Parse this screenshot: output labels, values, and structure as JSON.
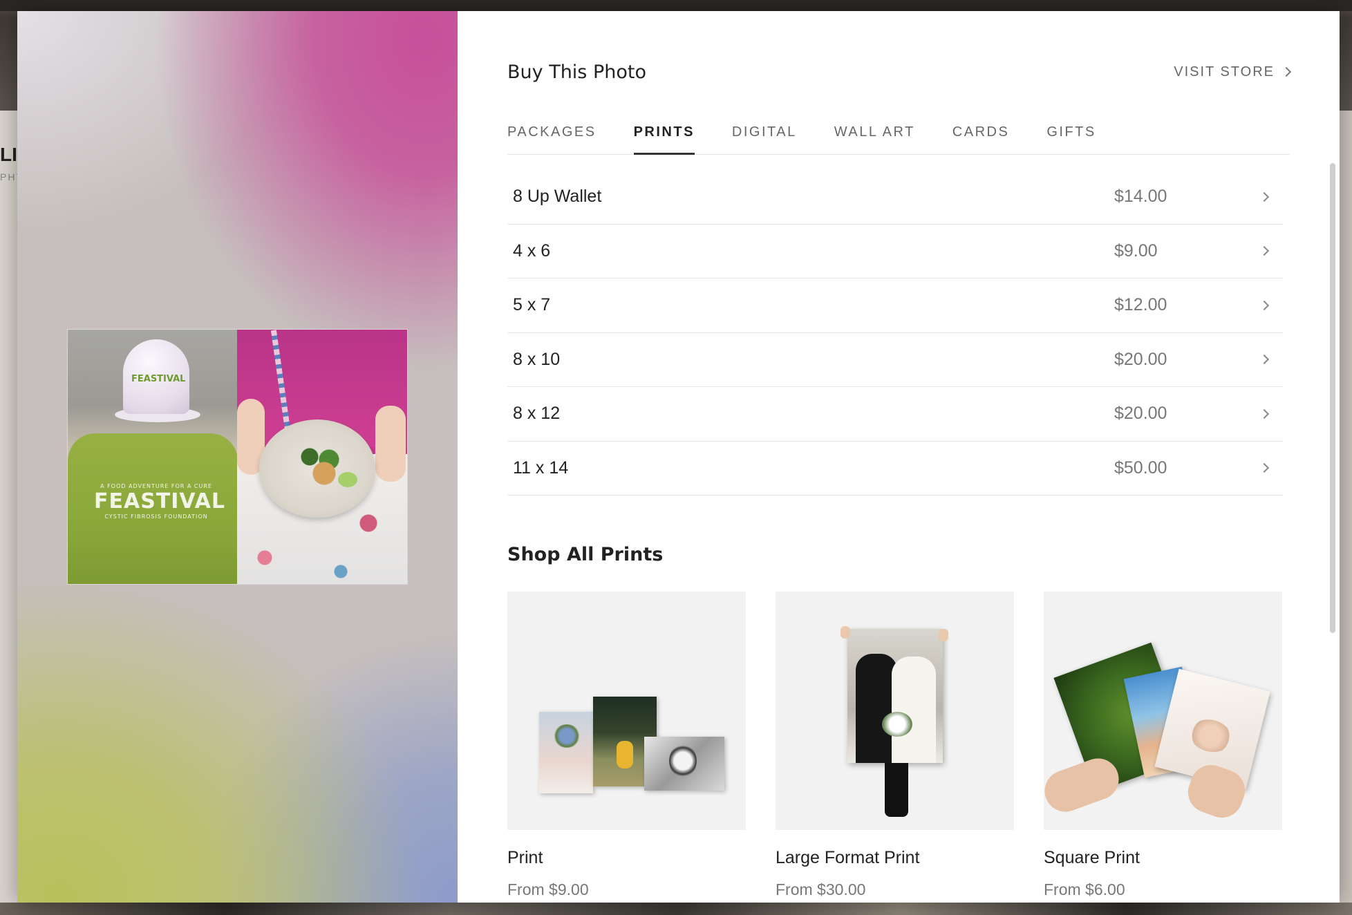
{
  "background": {
    "left_partial_title": "LI",
    "left_partial_subtitle": "PHY"
  },
  "panel": {
    "title": "Buy This Photo",
    "visit_store_label": "VISIT STORE"
  },
  "tabs": [
    {
      "label": "PACKAGES",
      "active": false
    },
    {
      "label": "PRINTS",
      "active": true
    },
    {
      "label": "DIGITAL",
      "active": false
    },
    {
      "label": "WALL ART",
      "active": false
    },
    {
      "label": "CARDS",
      "active": false
    },
    {
      "label": "GIFTS",
      "active": false
    }
  ],
  "prints": [
    {
      "name": "8 Up Wallet",
      "price": "$14.00"
    },
    {
      "name": "4 x 6",
      "price": "$9.00"
    },
    {
      "name": "5 x 7",
      "price": "$12.00"
    },
    {
      "name": "8 x 10",
      "price": "$20.00"
    },
    {
      "name": "8 x 12",
      "price": "$20.00"
    },
    {
      "name": "11 x 14",
      "price": "$50.00"
    }
  ],
  "shop": {
    "title": "Shop All Prints",
    "products": [
      {
        "name": "Print",
        "price": "From $9.00"
      },
      {
        "name": "Large Format Print",
        "price": "From $30.00"
      },
      {
        "name": "Square Print",
        "price": "From $6.00"
      }
    ]
  },
  "photo": {
    "cap_text": "FEASTIVAL",
    "shirt_top_text": "A FOOD ADVENTURE FOR A CURE",
    "shirt_main_text": "FEASTIVAL",
    "shirt_bottom_text": "CYSTIC FIBROSIS FOUNDATION"
  }
}
